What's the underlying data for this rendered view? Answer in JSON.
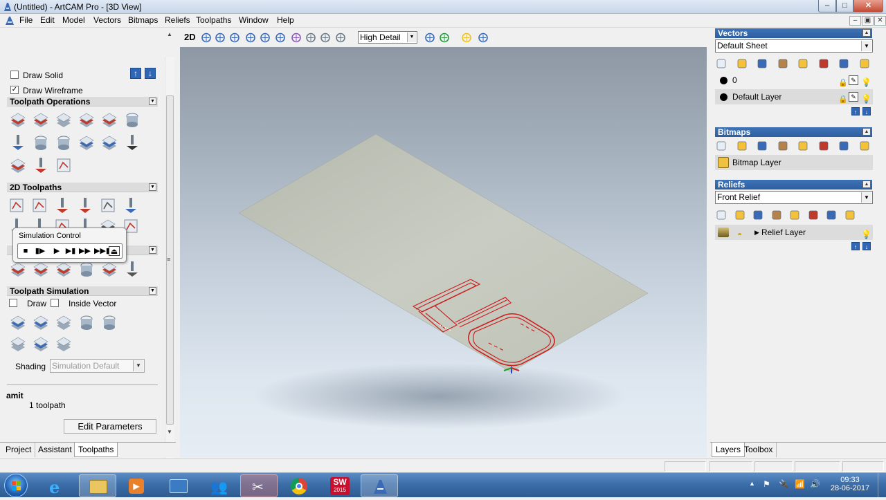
{
  "window": {
    "title": "(Untitled) - ArtCAM Pro - [3D View]",
    "controls": [
      "–",
      "□",
      "✕"
    ],
    "mdi_controls": [
      "–",
      "▣",
      "✕"
    ]
  },
  "menu": [
    "File",
    "Edit",
    "Model",
    "Vectors",
    "Bitmaps",
    "Reliefs",
    "Toolpaths",
    "Window",
    "Help"
  ],
  "left": {
    "draw_solid": {
      "label": "Draw Solid",
      "checked": false
    },
    "draw_wireframe": {
      "label": "Draw Wireframe",
      "checked": true
    },
    "toolpath_operations": "Toolpath Operations",
    "toolpaths_2d": "2D Toolpaths",
    "toolpath_simulation": "Toolpath Simulation",
    "sim_draw": {
      "label": "Draw",
      "checked": false
    },
    "sim_inside_vector": {
      "label": "Inside Vector",
      "checked": false
    },
    "shading_label": "Shading",
    "shading_value": "Simulation Default",
    "toolpath_name": "amit",
    "toolpath_count": "1 toolpath",
    "edit_parameters": "Edit Parameters",
    "tabs": [
      "Project",
      "Assistant",
      "Toolpaths"
    ],
    "active_tab": "Toolpaths"
  },
  "sim_control": {
    "title": "Simulation Control",
    "buttons": [
      "stop-icon",
      "step-play-icon",
      "play-icon",
      "step-forward-icon",
      "fast-forward-icon",
      "skip-end-icon",
      "eject-icon"
    ]
  },
  "view_toolbar": {
    "mode": "2D",
    "detail_value": "High Detail"
  },
  "right": {
    "vectors": {
      "title": "Vectors",
      "sheet": "Default Sheet",
      "layers": [
        "0",
        "Default Layer"
      ]
    },
    "bitmaps": {
      "title": "Bitmaps",
      "layer": "Bitmap Layer"
    },
    "reliefs": {
      "title": "Reliefs",
      "relief": "Front Relief",
      "layer": "Relief Layer"
    },
    "tabs": [
      "Layers",
      "Toolbox"
    ],
    "active_tab": "Layers"
  },
  "taskbar": {
    "time": "09:33",
    "date": "28-06-2017",
    "sw_label": "SW",
    "sw_year": "2015"
  },
  "colors": {
    "title_blue": "#2d5e9f",
    "toolpath_red": "#cc1f1f",
    "plane": "#c4c8bc"
  }
}
